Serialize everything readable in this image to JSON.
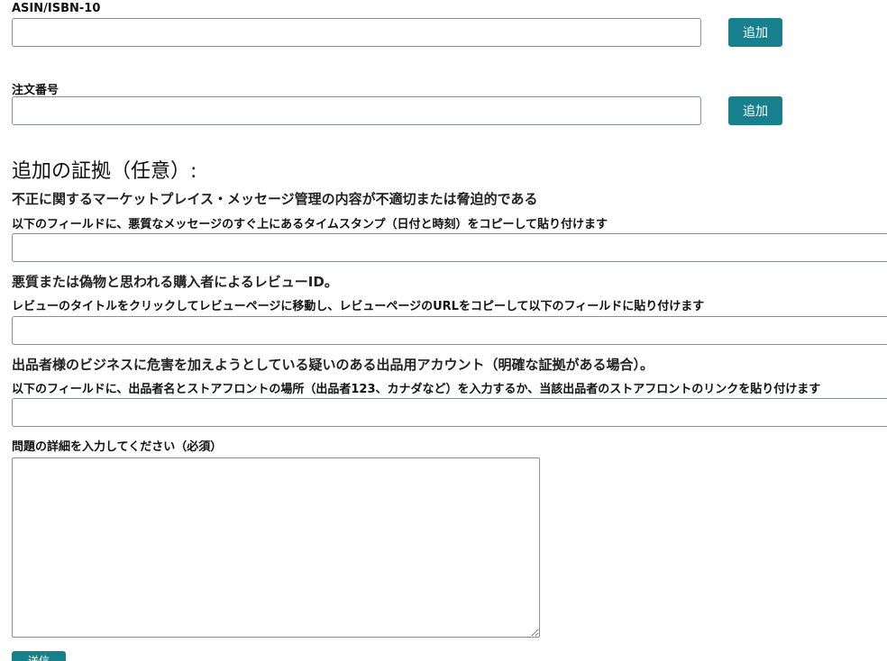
{
  "asin": {
    "label": "ASIN/ISBN-10",
    "value": "",
    "add_label": "追加"
  },
  "order": {
    "label": "注文番号",
    "value": "",
    "add_label": "追加"
  },
  "evidence": {
    "title": "追加の証拠（任意）:",
    "messages": {
      "heading": "不正に関するマーケットプレイス・メッセージ管理の内容が不適切または脅迫的である",
      "instruction": "以下のフィールドに、悪質なメッセージのすぐ上にあるタイムスタンプ（日付と時刻）をコピーして貼り付けます",
      "value": ""
    },
    "review": {
      "heading": "悪質または偽物と思われる購入者によるレビューID。",
      "instruction": "レビューのタイトルをクリックしてレビューページに移動し、レビューページのURLをコピーして以下のフィールドに貼り付けます",
      "value": ""
    },
    "seller": {
      "heading": "出品者様のビジネスに危害を加えようとしている疑いのある出品用アカウント（明確な証拠がある場合）。",
      "instruction": "以下のフィールドに、出品者名とストアフロントの場所（出品者123、カナダなど）を入力するか、当該出品者のストアフロントのリンクを貼り付けます",
      "value": ""
    }
  },
  "details": {
    "label": "問題の詳細を入力してください（必須）",
    "value": ""
  },
  "submit": {
    "label": "送信"
  }
}
